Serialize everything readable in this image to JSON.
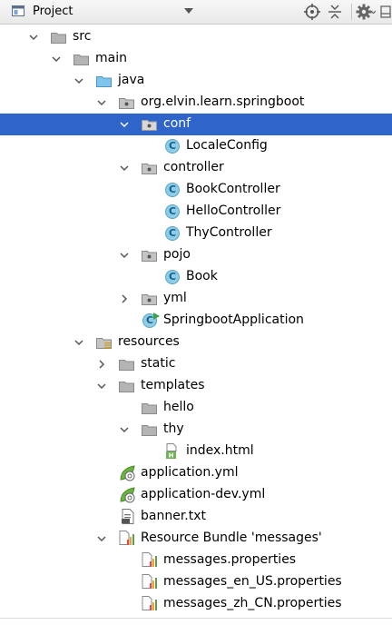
{
  "header": {
    "title": "Project",
    "icons": [
      "project-icon",
      "target-icon",
      "collapse-icon",
      "gear-icon",
      "hide-icon"
    ]
  },
  "tree": [
    {
      "label": "src"
    },
    {
      "label": "main"
    },
    {
      "label": "java"
    },
    {
      "label": "org.elvin.learn.springboot"
    },
    {
      "label": "conf"
    },
    {
      "label": "LocaleConfig"
    },
    {
      "label": "controller"
    },
    {
      "label": "BookController"
    },
    {
      "label": "HelloController"
    },
    {
      "label": "ThyController"
    },
    {
      "label": "pojo"
    },
    {
      "label": "Book"
    },
    {
      "label": "yml"
    },
    {
      "label": "SpringbootApplication"
    },
    {
      "label": "resources"
    },
    {
      "label": "static"
    },
    {
      "label": "templates"
    },
    {
      "label": "hello"
    },
    {
      "label": "thy"
    },
    {
      "label": "index.html"
    },
    {
      "label": "application.yml"
    },
    {
      "label": "application-dev.yml"
    },
    {
      "label": "banner.txt"
    },
    {
      "label": "Resource Bundle 'messages'"
    },
    {
      "label": "messages.properties"
    },
    {
      "label": "messages_en_US.properties"
    },
    {
      "label": "messages_zh_CN.properties"
    }
  ],
  "colors": {
    "selection": "#2f65ca",
    "class_badge": "#8ccde8",
    "folder": "#a8a8a8",
    "java_folder": "#7fc4ea"
  }
}
